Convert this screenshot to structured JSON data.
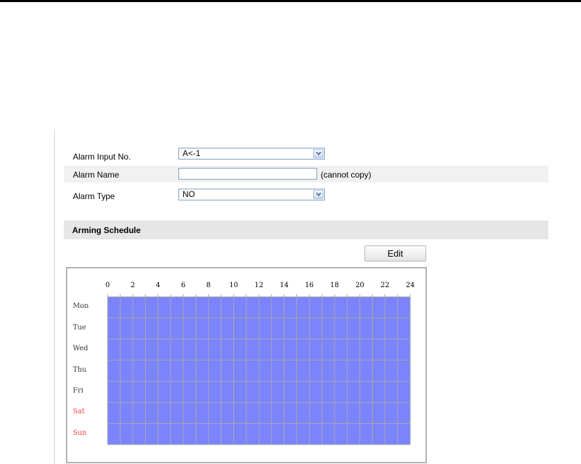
{
  "form": {
    "alarm_input": {
      "label": "Alarm Input No.",
      "value": "A<-1"
    },
    "alarm_name": {
      "label": "Alarm Name",
      "value": "",
      "note": "(cannot copy)"
    },
    "alarm_type": {
      "label": "Alarm Type",
      "value": "NO"
    }
  },
  "schedule": {
    "section_title": "Arming Schedule",
    "edit_label": "Edit",
    "hour_labels": [
      "0",
      "2",
      "4",
      "6",
      "8",
      "10",
      "12",
      "14",
      "16",
      "18",
      "20",
      "22",
      "24"
    ],
    "days": [
      {
        "label": "Mon",
        "weekend": false
      },
      {
        "label": "Tue",
        "weekend": false
      },
      {
        "label": "Wed",
        "weekend": false
      },
      {
        "label": "Thu",
        "weekend": false
      },
      {
        "label": "Fri",
        "weekend": false
      },
      {
        "label": "Sat",
        "weekend": true
      },
      {
        "label": "Sun",
        "weekend": true
      }
    ],
    "armed_fraction": 1.0,
    "fill_color": "#7b84fc",
    "grid_line_color": "#a8a8a8",
    "weekend_label_color": "#ff3b3b"
  }
}
